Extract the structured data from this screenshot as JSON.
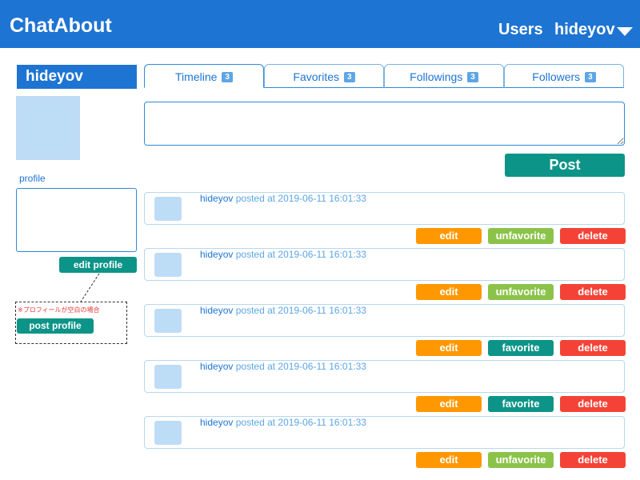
{
  "header": {
    "brand": "ChatAbout",
    "nav_users": "Users",
    "nav_user": "hideyov"
  },
  "sidebar": {
    "username": "hideyov",
    "profile_label": "profile",
    "edit_profile": "edit profile",
    "note": "※プロフィールが空白の場合",
    "post_profile": "post profile"
  },
  "tabs": [
    {
      "label": "Timeline",
      "count": "3"
    },
    {
      "label": "Favorites",
      "count": "3"
    },
    {
      "label": "Followings",
      "count": "3"
    },
    {
      "label": "Followers",
      "count": "3"
    }
  ],
  "composer": {
    "post_label": "Post"
  },
  "posts": [
    {
      "user": "hideyov",
      "meta": "posted at 2019-06-11 16:01:33",
      "edit": "edit",
      "fav": "unfavorite",
      "delete": "delete"
    },
    {
      "user": "hideyov",
      "meta": "posted at 2019-06-11 16:01:33",
      "edit": "edit",
      "fav": "unfavorite",
      "delete": "delete"
    },
    {
      "user": "hideyov",
      "meta": "posted at 2019-06-11 16:01:33",
      "edit": "edit",
      "fav": "favorite",
      "delete": "delete"
    },
    {
      "user": "hideyov",
      "meta": "posted at 2019-06-11 16:01:33",
      "edit": "edit",
      "fav": "favorite",
      "delete": "delete"
    },
    {
      "user": "hideyov",
      "meta": "posted at 2019-06-11 16:01:33",
      "edit": "edit",
      "fav": "unfavorite",
      "delete": "delete"
    }
  ],
  "colors": {
    "primary": "#1e74d2",
    "teal": "#0d9488",
    "edit": "#ff9800",
    "unfavorite": "#8bc34a",
    "favorite": "#0d9488",
    "delete": "#f44336"
  }
}
